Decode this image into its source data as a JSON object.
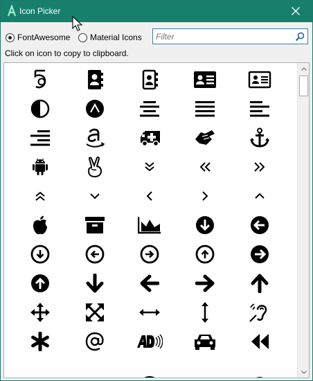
{
  "window": {
    "title": "Icon Picker",
    "app_icon": "app-logo-a-icon",
    "close_icon": "close-icon",
    "accent_color": "#16806d"
  },
  "toolbar": {
    "radio_options": [
      {
        "label": "FontAwesome",
        "selected": true
      },
      {
        "label": "Material Icons",
        "selected": false
      }
    ],
    "filter": {
      "placeholder": "Filter",
      "value": ""
    },
    "search_icon": "search-icon"
  },
  "hint": "Click on icon to copy to clipboard.",
  "icons": [
    [
      "500px-icon",
      "address-book-icon",
      "address-book-alt-icon",
      "address-card-icon",
      "address-card-alt-icon"
    ],
    [
      "adjust-icon",
      "affiliatetheme-icon",
      "align-center-icon",
      "align-justify-icon",
      "align-left-icon"
    ],
    [
      "align-right-icon",
      "amazon-icon",
      "ambulance-icon",
      "american-sign-language-icon",
      "anchor-icon"
    ],
    [
      "android-icon",
      "angellist-icon",
      "angle-double-down-icon",
      "angle-double-left-icon",
      "angle-double-right-icon"
    ],
    [
      "angle-double-up-icon",
      "angle-down-icon",
      "angle-left-icon",
      "angle-right-icon",
      "angle-up-icon"
    ],
    [
      "apple-icon",
      "archive-icon",
      "area-chart-icon",
      "arrow-circle-down-icon",
      "arrow-circle-left-icon"
    ],
    [
      "arrow-circle-o-down-icon",
      "arrow-circle-o-left-icon",
      "arrow-circle-o-right-icon",
      "arrow-circle-o-up-icon",
      "arrow-circle-right-icon"
    ],
    [
      "arrow-circle-up-icon",
      "arrow-down-icon",
      "arrow-left-icon",
      "arrow-right-icon",
      "arrow-up-icon"
    ],
    [
      "arrows-icon",
      "arrows-alt-icon",
      "arrows-h-icon",
      "arrows-v-icon",
      "assistive-listening-icon"
    ],
    [
      "asterisk-icon",
      "at-icon",
      "audio-description-icon",
      "automobile-icon",
      "backward-icon"
    ]
  ]
}
